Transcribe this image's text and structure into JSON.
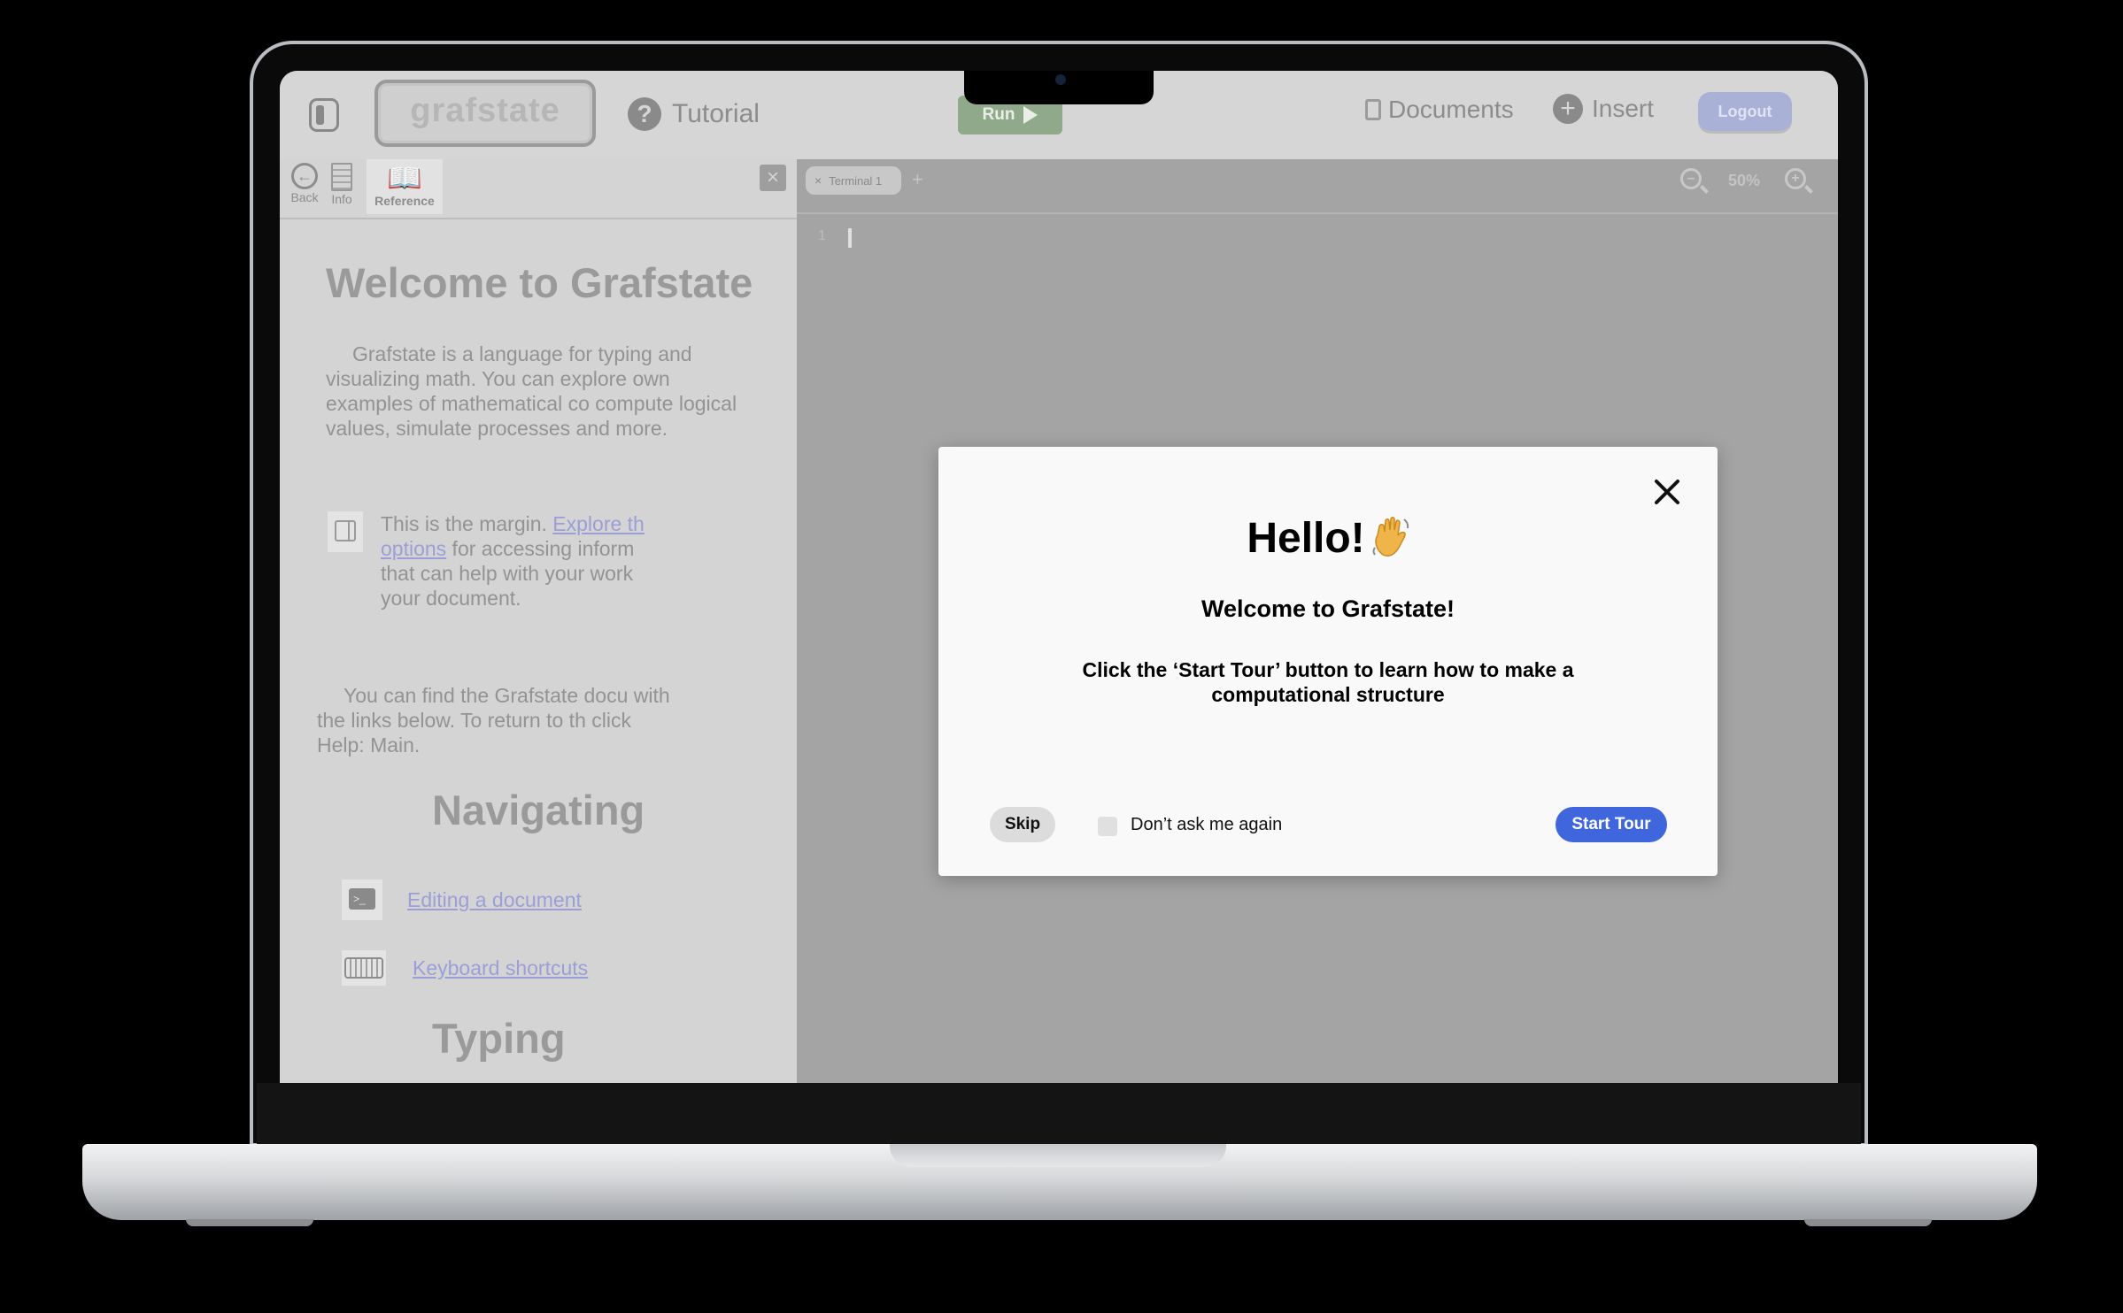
{
  "topbar": {
    "logo": "grafstate",
    "tutorial": "Tutorial",
    "run": "Run",
    "documents": "Documents",
    "insert": "Insert",
    "logout": "Logout"
  },
  "left_panel": {
    "toolbar": {
      "back": "Back",
      "info": "Info",
      "reference": "Reference"
    },
    "heading": "Welcome to Grafstate",
    "intro": "Grafstate is a language for typing and visualizing math. You can explore own examples of mathematical co compute logical values, simulate processes and more.",
    "margin_text_pre": "This is the margin. ",
    "margin_link1": "Explore th",
    "margin_link2": "options",
    "margin_text_post": " for accessing inform that can help with your work your document.",
    "help_text": "You can find the Grafstate docu with the links below. To return to th click       Help: Main.",
    "navigating_heading": "Navigating",
    "links": [
      "Editing a document",
      "Keyboard shortcuts"
    ],
    "typing_heading": "Typing"
  },
  "editor": {
    "tab": "Terminal 1",
    "tab_close": "×",
    "add_tab": "+",
    "zoom": "50%",
    "line_number": "1"
  },
  "modal": {
    "title": "Hello!",
    "subtitle": "Welcome to Grafstate!",
    "instruction": "Click the ‘Start Tour’ button to learn how to make a computational structure",
    "skip": "Skip",
    "dont_ask": "Don’t ask me again",
    "start_tour": "Start Tour",
    "dont_ask_checked": false
  },
  "colors": {
    "accent": "#3f66dc",
    "link": "#9a9fd6",
    "run": "#90a98a",
    "logout": "#aab1d6"
  },
  "icons": [
    "sidebar-toggle-icon",
    "help-icon",
    "play-icon",
    "document-icon",
    "plus-icon",
    "back-icon",
    "page-icon",
    "book-icon",
    "close-icon",
    "margin-icon",
    "terminal-icon",
    "keyboard-icon",
    "zoom-out-icon",
    "zoom-in-icon",
    "wave-icon"
  ]
}
